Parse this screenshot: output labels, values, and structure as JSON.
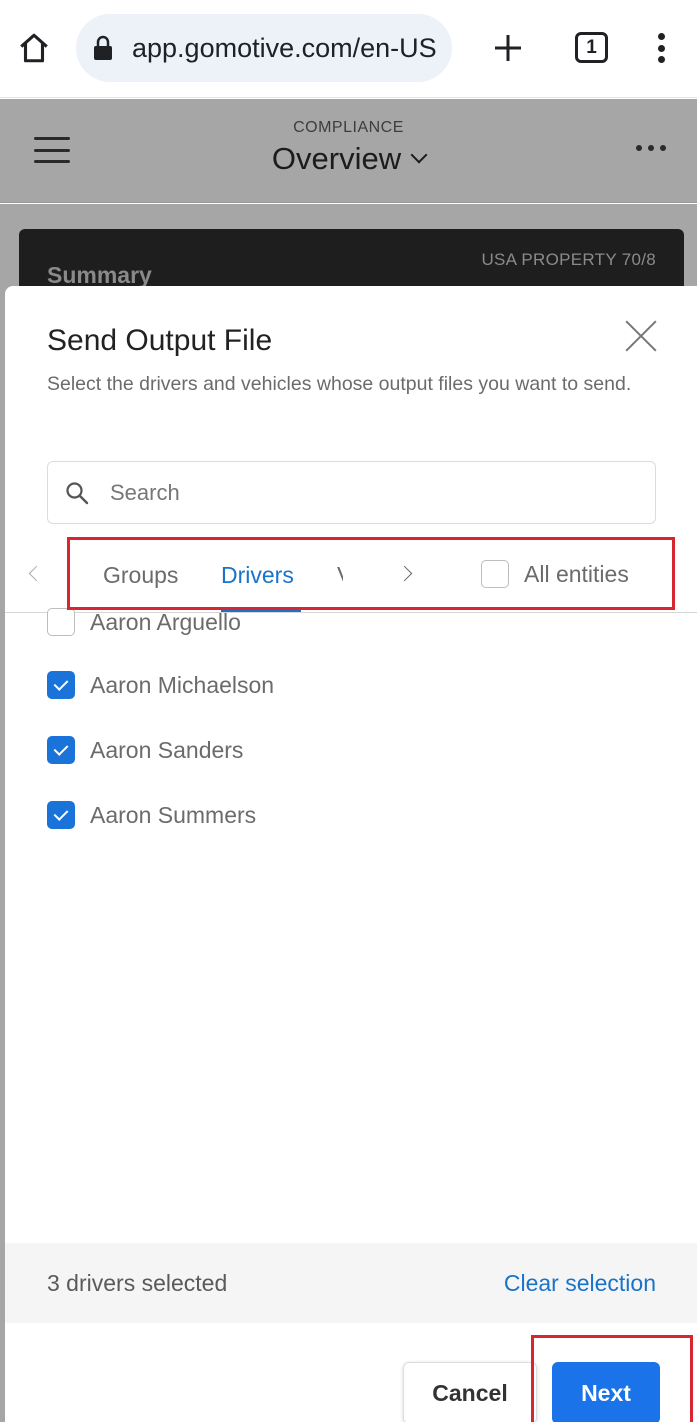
{
  "browser": {
    "url": "app.gomotive.com/en-US",
    "tab_count": "1"
  },
  "header": {
    "section": "COMPLIANCE",
    "title": "Overview"
  },
  "summary_card": {
    "title": "Summary",
    "ruleset": "USA PROPERTY 70/8"
  },
  "modal": {
    "title": "Send Output File",
    "description": "Select the drivers and vehicles whose output files you want to send.",
    "search_placeholder": "Search",
    "tabs": [
      {
        "label": "Groups",
        "active": false
      },
      {
        "label": "Drivers",
        "active": true
      },
      {
        "label": "Vehicles",
        "active": false
      }
    ],
    "all_entities_label": "All entities",
    "all_entities_checked": false,
    "drivers": [
      {
        "name": "Aaron Arguello",
        "checked": false
      },
      {
        "name": "Aaron Michaelson",
        "checked": true
      },
      {
        "name": "Aaron Sanders",
        "checked": true
      },
      {
        "name": "Aaron Summers",
        "checked": true
      }
    ],
    "selected_text": "3 drivers selected",
    "clear_selection": "Clear selection",
    "cancel_label": "Cancel",
    "next_label": "Next"
  },
  "colors": {
    "accent": "#1a73e8",
    "link": "#1a73c8",
    "highlight_box": "#d7262f",
    "overlay": "#a6a6a6"
  }
}
